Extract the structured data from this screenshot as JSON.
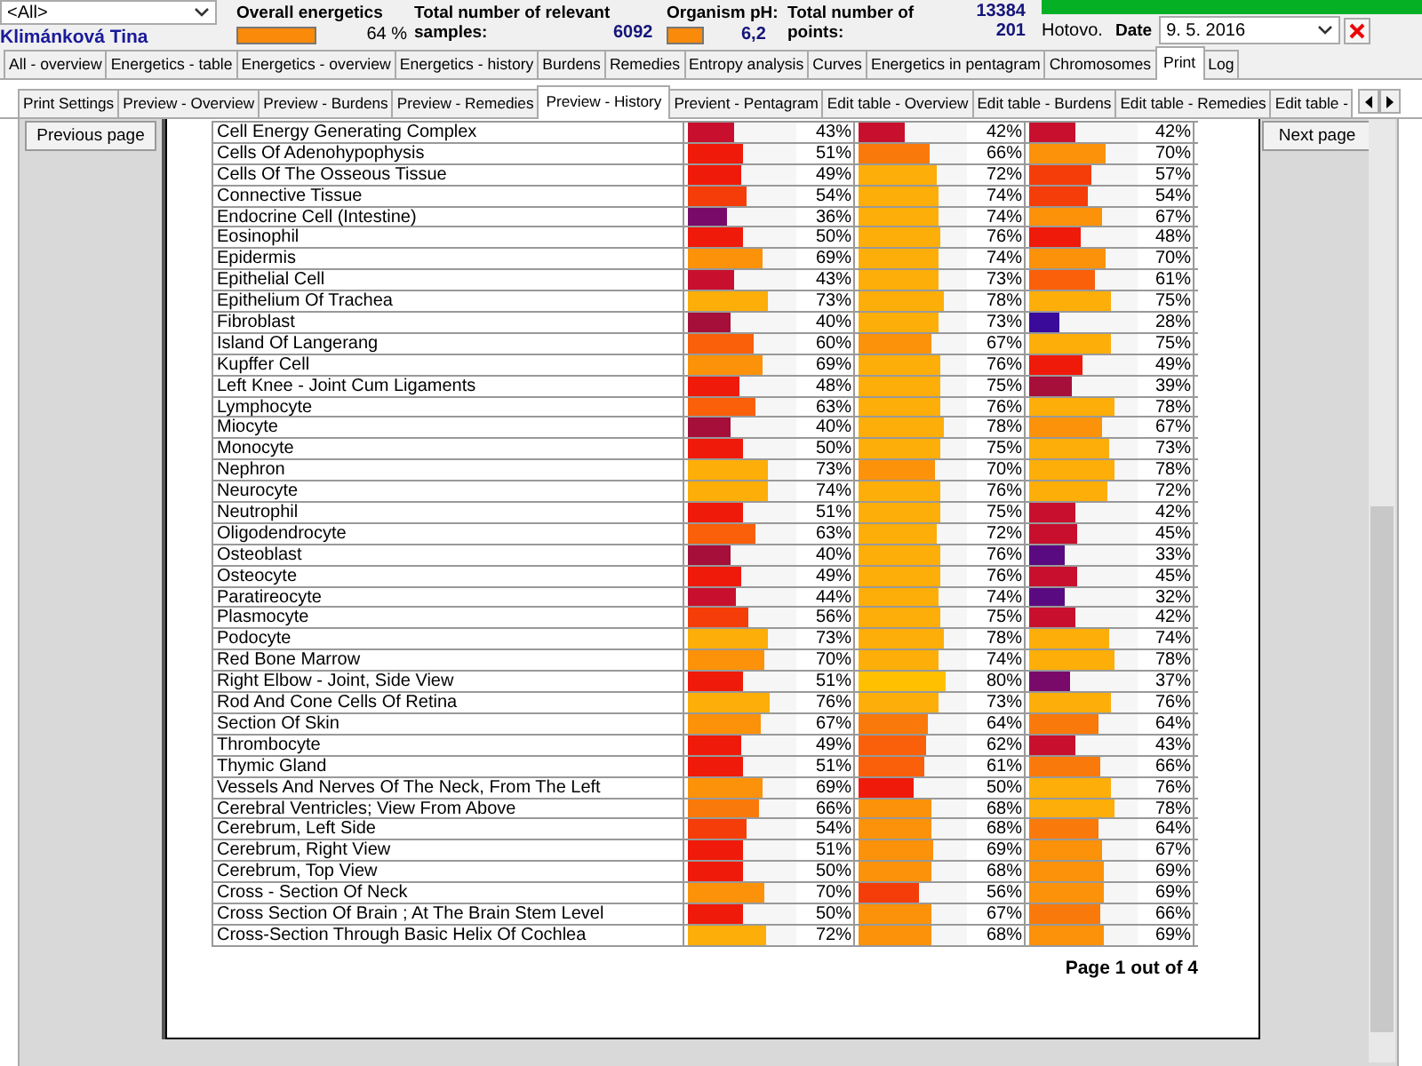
{
  "header": {
    "patient_filter": "<All>",
    "patient_name": "Klimánková Tina",
    "overall_energetics": {
      "label": "Overall energetics",
      "reading": "64 %"
    },
    "samples": {
      "label": "Total number of relevant samples:",
      "value": "6092"
    },
    "ph": {
      "label": "Organism pH:",
      "value": "6,2"
    },
    "points": {
      "label": "Total number of points:",
      "value_1": "13384",
      "value_2": "201"
    },
    "progress": {
      "level": 1
    },
    "status": "Hotovo.",
    "date": {
      "label": "Date",
      "value": "9. 5. 2016"
    }
  },
  "main_tabs": [
    {
      "label": "All - overview",
      "selected": false
    },
    {
      "label": "Energetics - table",
      "selected": false
    },
    {
      "label": "Energetics - overview",
      "selected": false
    },
    {
      "label": "Energetics - history",
      "selected": false
    },
    {
      "label": "Burdens",
      "selected": false
    },
    {
      "label": "Remedies",
      "selected": false
    },
    {
      "label": "Entropy analysis",
      "selected": false
    },
    {
      "label": "Curves",
      "selected": false
    },
    {
      "label": "Energetics in pentagram",
      "selected": false
    },
    {
      "label": "Chromosomes",
      "selected": false
    },
    {
      "label": "Print",
      "selected": true
    },
    {
      "label": "Log",
      "selected": false
    }
  ],
  "sub_tabs": [
    {
      "label": "Print Settings",
      "selected": false
    },
    {
      "label": "Preview - Overview",
      "selected": false
    },
    {
      "label": "Preview - Burdens",
      "selected": false
    },
    {
      "label": "Preview - Remedies",
      "selected": false
    },
    {
      "label": "Preview - History",
      "selected": true
    },
    {
      "label": "Previent - Pentagram",
      "selected": false
    },
    {
      "label": "Edit table - Overview",
      "selected": false
    },
    {
      "label": "Edit table - Burdens",
      "selected": false
    },
    {
      "label": "Edit table - Remedies",
      "selected": false
    },
    {
      "label": "Edit table -",
      "selected": false
    }
  ],
  "buttons": {
    "previous": "Previous page",
    "next": "Next page"
  },
  "table": {
    "rows": [
      {
        "name": "Cell Energy Generating Complex",
        "cells": [
          {
            "level": 0.43,
            "reading": "43%"
          },
          {
            "level": 0.42,
            "reading": "42%"
          },
          {
            "level": 0.42,
            "reading": "42%"
          }
        ]
      },
      {
        "name": "Cells Of Adenohypophysis",
        "cells": [
          {
            "level": 0.51,
            "reading": "51%"
          },
          {
            "level": 0.66,
            "reading": "66%"
          },
          {
            "level": 0.7,
            "reading": "70%"
          }
        ]
      },
      {
        "name": "Cells Of The Osseous Tissue",
        "cells": [
          {
            "level": 0.49,
            "reading": "49%"
          },
          {
            "level": 0.72,
            "reading": "72%"
          },
          {
            "level": 0.57,
            "reading": "57%"
          }
        ]
      },
      {
        "name": "Connective Tissue",
        "cells": [
          {
            "level": 0.54,
            "reading": "54%"
          },
          {
            "level": 0.74,
            "reading": "74%"
          },
          {
            "level": 0.54,
            "reading": "54%"
          }
        ]
      },
      {
        "name": "Endocrine Cell (Intestine)",
        "cells": [
          {
            "level": 0.36,
            "reading": "36%"
          },
          {
            "level": 0.74,
            "reading": "74%"
          },
          {
            "level": 0.67,
            "reading": "67%"
          }
        ]
      },
      {
        "name": "Eosinophil",
        "cells": [
          {
            "level": 0.5,
            "reading": "50%"
          },
          {
            "level": 0.76,
            "reading": "76%"
          },
          {
            "level": 0.48,
            "reading": "48%"
          }
        ]
      },
      {
        "name": "Epidermis",
        "cells": [
          {
            "level": 0.69,
            "reading": "69%"
          },
          {
            "level": 0.74,
            "reading": "74%"
          },
          {
            "level": 0.7,
            "reading": "70%"
          }
        ]
      },
      {
        "name": "Epithelial Cell",
        "cells": [
          {
            "level": 0.43,
            "reading": "43%"
          },
          {
            "level": 0.73,
            "reading": "73%"
          },
          {
            "level": 0.61,
            "reading": "61%"
          }
        ]
      },
      {
        "name": "Epithelium Of Trachea",
        "cells": [
          {
            "level": 0.73,
            "reading": "73%"
          },
          {
            "level": 0.78,
            "reading": "78%"
          },
          {
            "level": 0.75,
            "reading": "75%"
          }
        ]
      },
      {
        "name": "Fibroblast",
        "cells": [
          {
            "level": 0.4,
            "reading": "40%"
          },
          {
            "level": 0.73,
            "reading": "73%"
          },
          {
            "level": 0.28,
            "reading": "28%"
          }
        ]
      },
      {
        "name": "Island Of Langerang",
        "cells": [
          {
            "level": 0.6,
            "reading": "60%"
          },
          {
            "level": 0.67,
            "reading": "67%"
          },
          {
            "level": 0.75,
            "reading": "75%"
          }
        ]
      },
      {
        "name": "Kupffer Cell",
        "cells": [
          {
            "level": 0.69,
            "reading": "69%"
          },
          {
            "level": 0.76,
            "reading": "76%"
          },
          {
            "level": 0.49,
            "reading": "49%"
          }
        ]
      },
      {
        "name": "Left Knee - Joint Cum Ligaments",
        "cells": [
          {
            "level": 0.48,
            "reading": "48%"
          },
          {
            "level": 0.75,
            "reading": "75%"
          },
          {
            "level": 0.39,
            "reading": "39%"
          }
        ]
      },
      {
        "name": "Lymphocyte",
        "cells": [
          {
            "level": 0.63,
            "reading": "63%"
          },
          {
            "level": 0.76,
            "reading": "76%"
          },
          {
            "level": 0.78,
            "reading": "78%"
          }
        ]
      },
      {
        "name": "Miocyte",
        "cells": [
          {
            "level": 0.4,
            "reading": "40%"
          },
          {
            "level": 0.78,
            "reading": "78%"
          },
          {
            "level": 0.67,
            "reading": "67%"
          }
        ]
      },
      {
        "name": "Monocyte",
        "cells": [
          {
            "level": 0.5,
            "reading": "50%"
          },
          {
            "level": 0.75,
            "reading": "75%"
          },
          {
            "level": 0.73,
            "reading": "73%"
          }
        ]
      },
      {
        "name": "Nephron",
        "cells": [
          {
            "level": 0.73,
            "reading": "73%"
          },
          {
            "level": 0.7,
            "reading": "70%"
          },
          {
            "level": 0.78,
            "reading": "78%"
          }
        ]
      },
      {
        "name": "Neurocyte",
        "cells": [
          {
            "level": 0.74,
            "reading": "74%"
          },
          {
            "level": 0.76,
            "reading": "76%"
          },
          {
            "level": 0.72,
            "reading": "72%"
          }
        ]
      },
      {
        "name": "Neutrophil",
        "cells": [
          {
            "level": 0.51,
            "reading": "51%"
          },
          {
            "level": 0.75,
            "reading": "75%"
          },
          {
            "level": 0.42,
            "reading": "42%"
          }
        ]
      },
      {
        "name": "Oligodendrocyte",
        "cells": [
          {
            "level": 0.63,
            "reading": "63%"
          },
          {
            "level": 0.72,
            "reading": "72%"
          },
          {
            "level": 0.45,
            "reading": "45%"
          }
        ]
      },
      {
        "name": "Osteoblast",
        "cells": [
          {
            "level": 0.4,
            "reading": "40%"
          },
          {
            "level": 0.76,
            "reading": "76%"
          },
          {
            "level": 0.33,
            "reading": "33%"
          }
        ]
      },
      {
        "name": "Osteocyte",
        "cells": [
          {
            "level": 0.49,
            "reading": "49%"
          },
          {
            "level": 0.76,
            "reading": "76%"
          },
          {
            "level": 0.45,
            "reading": "45%"
          }
        ]
      },
      {
        "name": "Paratireocyte",
        "cells": [
          {
            "level": 0.44,
            "reading": "44%"
          },
          {
            "level": 0.74,
            "reading": "74%"
          },
          {
            "level": 0.32,
            "reading": "32%"
          }
        ]
      },
      {
        "name": "Plasmocyte",
        "cells": [
          {
            "level": 0.56,
            "reading": "56%"
          },
          {
            "level": 0.75,
            "reading": "75%"
          },
          {
            "level": 0.42,
            "reading": "42%"
          }
        ]
      },
      {
        "name": "Podocyte",
        "cells": [
          {
            "level": 0.73,
            "reading": "73%"
          },
          {
            "level": 0.78,
            "reading": "78%"
          },
          {
            "level": 0.74,
            "reading": "74%"
          }
        ]
      },
      {
        "name": "Red Bone Marrow",
        "cells": [
          {
            "level": 0.7,
            "reading": "70%"
          },
          {
            "level": 0.74,
            "reading": "74%"
          },
          {
            "level": 0.78,
            "reading": "78%"
          }
        ]
      },
      {
        "name": "Right Elbow - Joint, Side View",
        "cells": [
          {
            "level": 0.51,
            "reading": "51%"
          },
          {
            "level": 0.8,
            "reading": "80%"
          },
          {
            "level": 0.37,
            "reading": "37%"
          }
        ]
      },
      {
        "name": "Rod And Cone Cells Of Retina",
        "cells": [
          {
            "level": 0.76,
            "reading": "76%"
          },
          {
            "level": 0.73,
            "reading": "73%"
          },
          {
            "level": 0.76,
            "reading": "76%"
          }
        ]
      },
      {
        "name": "Section Of Skin",
        "cells": [
          {
            "level": 0.67,
            "reading": "67%"
          },
          {
            "level": 0.64,
            "reading": "64%"
          },
          {
            "level": 0.64,
            "reading": "64%"
          }
        ]
      },
      {
        "name": "Thrombocyte",
        "cells": [
          {
            "level": 0.49,
            "reading": "49%"
          },
          {
            "level": 0.62,
            "reading": "62%"
          },
          {
            "level": 0.43,
            "reading": "43%"
          }
        ]
      },
      {
        "name": "Thymic Gland",
        "cells": [
          {
            "level": 0.51,
            "reading": "51%"
          },
          {
            "level": 0.61,
            "reading": "61%"
          },
          {
            "level": 0.66,
            "reading": "66%"
          }
        ]
      },
      {
        "name": "Vessels And Nerves Of The Neck, From The Left",
        "cells": [
          {
            "level": 0.69,
            "reading": "69%"
          },
          {
            "level": 0.5,
            "reading": "50%"
          },
          {
            "level": 0.76,
            "reading": "76%"
          }
        ]
      },
      {
        "name": "Cerebral Ventricles; View From Above",
        "cells": [
          {
            "level": 0.66,
            "reading": "66%"
          },
          {
            "level": 0.68,
            "reading": "68%"
          },
          {
            "level": 0.78,
            "reading": "78%"
          }
        ]
      },
      {
        "name": "Cerebrum, Left Side",
        "cells": [
          {
            "level": 0.54,
            "reading": "54%"
          },
          {
            "level": 0.68,
            "reading": "68%"
          },
          {
            "level": 0.64,
            "reading": "64%"
          }
        ]
      },
      {
        "name": "Cerebrum, Right View",
        "cells": [
          {
            "level": 0.51,
            "reading": "51%"
          },
          {
            "level": 0.69,
            "reading": "69%"
          },
          {
            "level": 0.67,
            "reading": "67%"
          }
        ]
      },
      {
        "name": "Cerebrum, Top View",
        "cells": [
          {
            "level": 0.5,
            "reading": "50%"
          },
          {
            "level": 0.68,
            "reading": "68%"
          },
          {
            "level": 0.69,
            "reading": "69%"
          }
        ]
      },
      {
        "name": "Cross - Section Of Neck",
        "cells": [
          {
            "level": 0.7,
            "reading": "70%"
          },
          {
            "level": 0.56,
            "reading": "56%"
          },
          {
            "level": 0.69,
            "reading": "69%"
          }
        ]
      },
      {
        "name": "Cross Section Of Brain ; At The Brain Stem Level",
        "cells": [
          {
            "level": 0.5,
            "reading": "50%"
          },
          {
            "level": 0.67,
            "reading": "67%"
          },
          {
            "level": 0.66,
            "reading": "66%"
          }
        ]
      },
      {
        "name": "Cross-Section Through Basic Helix Of Cochlea",
        "cells": [
          {
            "level": 0.72,
            "reading": "72%"
          },
          {
            "level": 0.68,
            "reading": "68%"
          },
          {
            "level": 0.69,
            "reading": "69%"
          }
        ]
      }
    ]
  },
  "page_indicator": "Page 1 out of 4"
}
